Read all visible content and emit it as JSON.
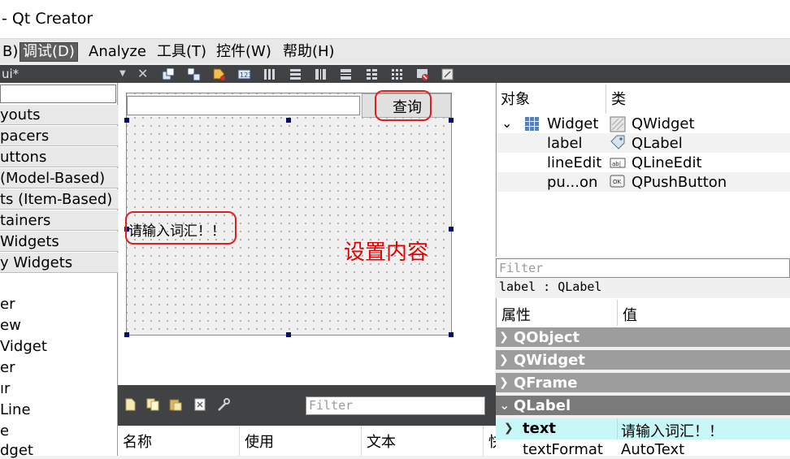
{
  "window": {
    "title": "- Qt Creator"
  },
  "menu": {
    "items": [
      "B)",
      "调试(D)",
      "Analyze",
      "工具(T)",
      "控件(W)",
      "帮助(H)"
    ],
    "active_index": 1
  },
  "editor_tab": {
    "filename": "ui*"
  },
  "toolbar_icons": [
    "edit-widgets-icon",
    "edit-signals-icon",
    "edit-buddies-icon",
    "edit-tab-order-icon",
    "layout-horizontal-icon",
    "layout-vertical-icon",
    "layout-splitter-h-icon",
    "layout-splitter-v-icon",
    "layout-form-icon",
    "layout-grid-icon",
    "break-layout-icon",
    "adjust-size-icon"
  ],
  "widget_box": {
    "categories": [
      "youts",
      "pacers",
      "uttons",
      "(Model-Based)",
      "ts (Item-Based)",
      "tainers",
      " Widgets",
      "y Widgets"
    ],
    "items": [
      "er",
      "ew",
      "Vidget",
      "er",
      "ır",
      "Line",
      "e",
      "dget"
    ]
  },
  "form": {
    "button_label": "查询",
    "label_text": "请输入词汇！！",
    "annotation": "设置内容",
    "annotation_color": "#e60000",
    "highlight_color": "#e02020"
  },
  "action_editor": {
    "filter_placeholder": "Filter",
    "columns": [
      "名称",
      "使用",
      "文本",
      "快"
    ],
    "icons": [
      "new-action-icon",
      "copy-action-icon",
      "paste-action-icon",
      "delete-action-icon",
      "settings-wrench-icon"
    ]
  },
  "object_inspector": {
    "columns": [
      "对象",
      "类"
    ],
    "rows": [
      {
        "object": "Widget",
        "class": "QWidget",
        "icon": "widget-grid-icon",
        "class_icon": "widget-class-icon"
      },
      {
        "object": "label",
        "class": "QLabel",
        "class_icon": "label-tag-icon"
      },
      {
        "object": "lineEdit",
        "class": "QLineEdit",
        "class_icon": "lineedit-icon"
      },
      {
        "object": "pu...on",
        "class": "QPushButton",
        "class_icon": "pushbutton-icon"
      }
    ]
  },
  "property_editor": {
    "filter_placeholder": "Filter",
    "current": "label : QLabel",
    "columns": [
      "属性",
      "值"
    ],
    "groups": [
      "QObject",
      "QWidget",
      "QFrame",
      "QLabel"
    ],
    "properties": [
      {
        "name": "text",
        "value": "请输入词汇！！"
      },
      {
        "name": "textFormat",
        "value": "AutoText"
      }
    ]
  }
}
